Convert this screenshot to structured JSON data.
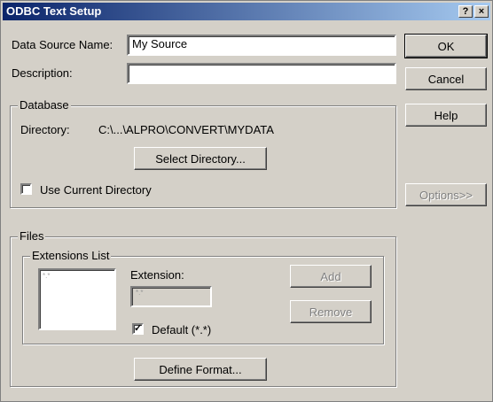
{
  "window": {
    "title": "ODBC Text Setup",
    "help_glyph": "?",
    "close_glyph": "×"
  },
  "fields": {
    "data_source_name_label": "Data Source Name:",
    "data_source_name_value": "My Source",
    "description_label": "Description:",
    "description_value": ""
  },
  "buttons": {
    "ok": "OK",
    "cancel": "Cancel",
    "help": "Help",
    "options": "Options>>",
    "select_directory": "Select Directory...",
    "add": "Add",
    "remove": "Remove",
    "define_format": "Define Format..."
  },
  "database": {
    "legend": "Database",
    "directory_label": "Directory:",
    "directory_value": "C:\\...\\ALPRO\\CONVERT\\MYDATA",
    "use_current_directory_label": "Use Current Directory",
    "use_current_directory_checked": false
  },
  "files": {
    "legend": "Files",
    "extensions_list_legend": "Extensions List",
    "extensions_items": [
      "*.*"
    ],
    "extension_label": "Extension:",
    "extension_value": "*.*",
    "default_label": "Default (*.*)",
    "default_checked": true
  },
  "colors": {
    "titlebar_start": "#0a246a",
    "titlebar_end": "#a6caf0",
    "face": "#d4d0c8"
  }
}
